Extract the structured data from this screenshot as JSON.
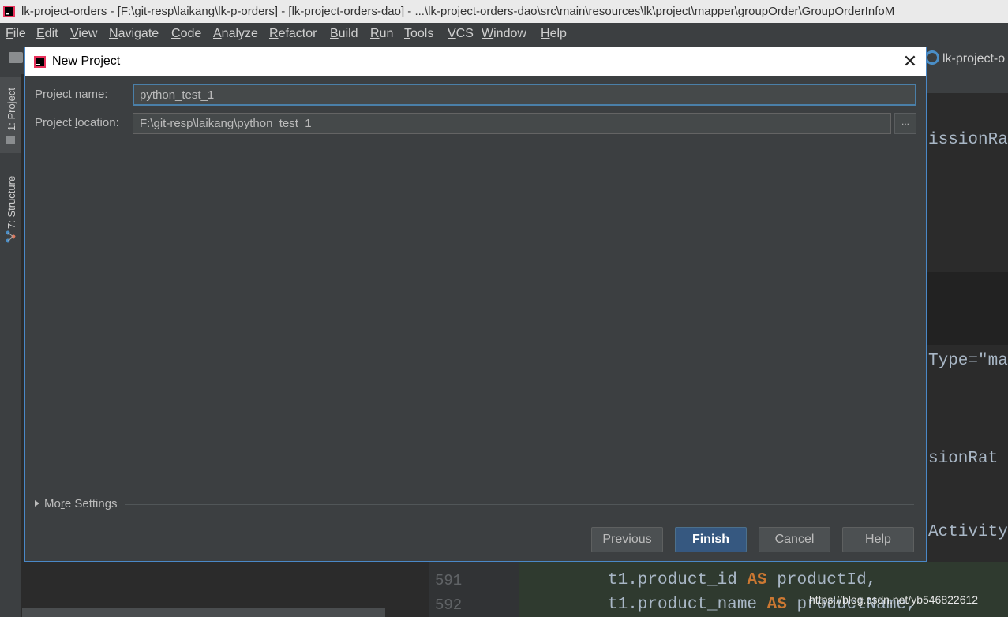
{
  "window": {
    "title": "lk-project-orders - [F:\\git-resp\\laikang\\lk-p-orders] - [lk-project-orders-dao] - ...\\lk-project-orders-dao\\src\\main\\resources\\lk\\project\\mapper\\groupOrder\\GroupOrderInfoM"
  },
  "menu": {
    "items": [
      "File",
      "Edit",
      "View",
      "Navigate",
      "Code",
      "Analyze",
      "Refactor",
      "Build",
      "Run",
      "Tools",
      "VCS",
      "Window",
      "Help"
    ]
  },
  "toolbar": {
    "tab_label": "lk-project-o"
  },
  "tool_stripe": {
    "project_tab": "1: Project",
    "structure_tab": "7: Structure"
  },
  "editor": {
    "fragments": [
      "issionRa",
      "Type=\"ma",
      "sionRat",
      "Activity"
    ],
    "line_numbers": [
      "591",
      "592"
    ],
    "line_591": {
      "pre": "t1.product_id ",
      "kw": "AS",
      "post": " productId,"
    },
    "line_592": {
      "pre": "t1.product_name ",
      "kw": "AS",
      "post": " productName,"
    },
    "partial_line": "  ̱   ̱  ̱ ̱ ̱,"
  },
  "watermark": "https://blog.csdn.net/yb546822612",
  "dialog": {
    "title": "New Project",
    "close_glyph": "✕",
    "project_name_label": {
      "pre": "Project n",
      "key": "a",
      "post": "me:"
    },
    "project_name_value": "python_test_1",
    "project_location_label": {
      "pre": "Project ",
      "key": "l",
      "post": "ocation:"
    },
    "project_location_value": "F:\\git-resp\\laikang\\python_test_1",
    "browse_label": "...",
    "more_settings": {
      "pre": "Mo",
      "key": "r",
      "post": "e Settings"
    },
    "buttons": {
      "previous": {
        "key": "P",
        "rest": "revious"
      },
      "finish": {
        "key": "F",
        "rest": "inish"
      },
      "cancel": "Cancel",
      "help": "Help"
    }
  },
  "colors": {
    "dialog_bg": "#3c3f41",
    "accent_border": "#4a88c7",
    "primary_button": "#365880",
    "keyword": "#cc7832"
  }
}
